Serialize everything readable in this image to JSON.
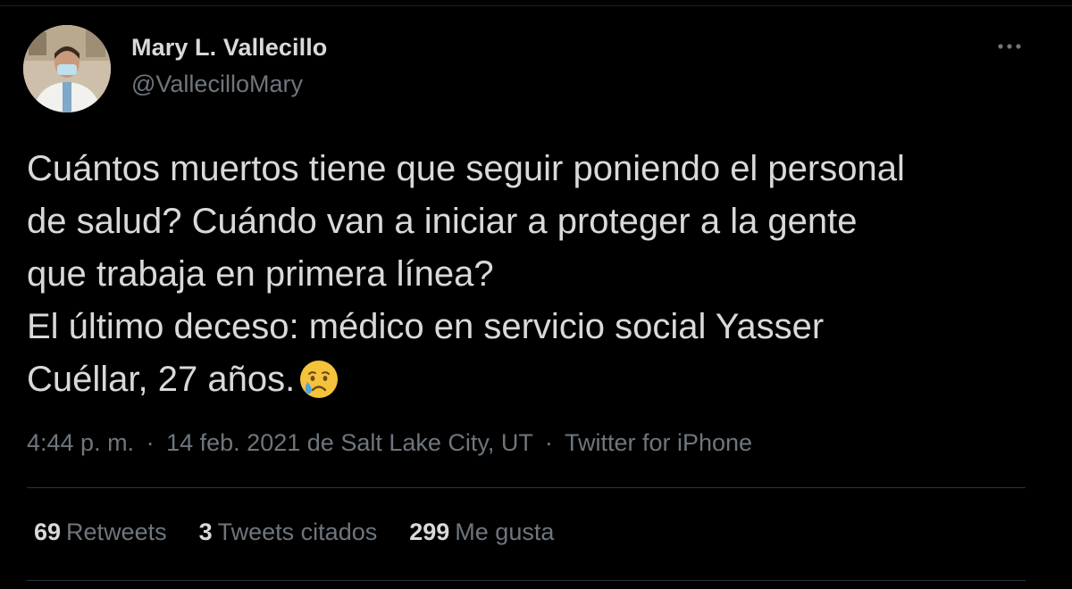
{
  "author": {
    "display_name": "Mary L. Vallecillo",
    "handle": "@VallecilloMary"
  },
  "tweet": {
    "lines": [
      "Cuántos muertos tiene que seguir poniendo el personal",
      "de salud? Cuándo van a iniciar a proteger a la gente",
      "que trabaja en primera línea?",
      "El último deceso: médico en servicio social Yasser",
      "Cuéllar, 27 años."
    ],
    "emoji": "crying-face-emoji"
  },
  "meta": {
    "time": "4:44 p. m.",
    "separator": "·",
    "date": "14 feb. 2021",
    "location_prefix": "de",
    "location": "Salt Lake City, UT",
    "client": "Twitter for iPhone"
  },
  "stats": {
    "retweets": {
      "count": "69",
      "label": "Retweets"
    },
    "quotes": {
      "count": "3",
      "label": "Tweets citados"
    },
    "likes": {
      "count": "299",
      "label": "Me gusta"
    }
  },
  "icons": {
    "more": "more-horizontal-icon"
  },
  "colors": {
    "background": "#000000",
    "text": "#d9d9d9",
    "secondary": "#6e767d",
    "divider": "#2f3336"
  }
}
